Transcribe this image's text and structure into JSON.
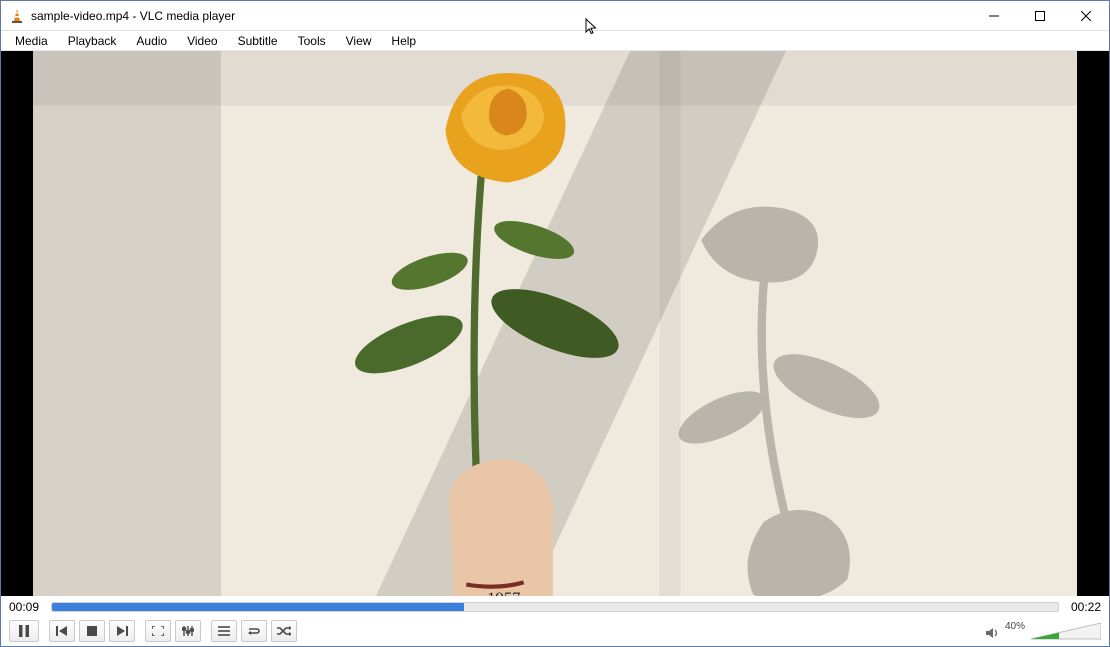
{
  "titlebar": {
    "title": "sample-video.mp4 - VLC media player"
  },
  "menu": {
    "items": [
      "Media",
      "Playback",
      "Audio",
      "Video",
      "Subtitle",
      "Tools",
      "View",
      "Help"
    ]
  },
  "playback": {
    "elapsed": "00:09",
    "total": "00:22",
    "progress_percent": 41
  },
  "volume": {
    "percent_label": "40%",
    "level_percent": 40
  },
  "icons": {
    "app": "vlc-cone-icon",
    "minimize": "minimize-icon",
    "maximize": "maximize-icon",
    "close": "close-icon",
    "pause": "pause-icon",
    "prev": "previous-icon",
    "stop": "stop-icon",
    "next": "next-icon",
    "fullscreen": "fullscreen-icon",
    "ext": "extended-settings-icon",
    "playlist": "playlist-icon",
    "loop": "loop-icon",
    "shuffle": "shuffle-icon",
    "speaker": "speaker-icon"
  }
}
